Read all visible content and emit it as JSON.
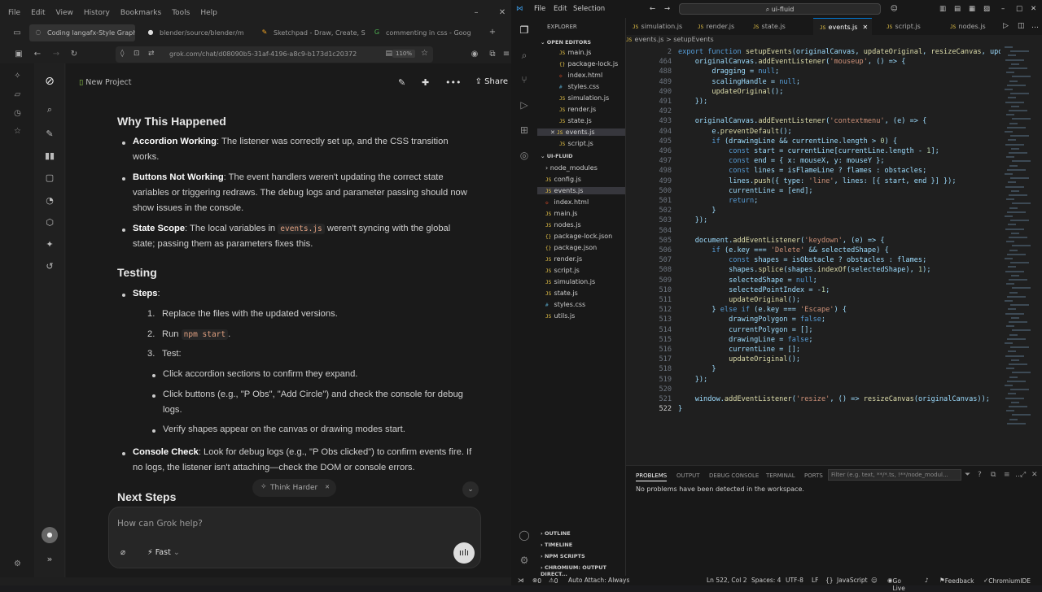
{
  "ff": {
    "menu": [
      "File",
      "Edit",
      "View",
      "History",
      "Bookmarks",
      "Tools",
      "Help"
    ],
    "tabs": [
      "Coding langafx-Style Graph",
      "blender/source/blender/m",
      "Sketchpad - Draw, Create, S",
      "commenting in css - Goog"
    ],
    "url": "grok.com/chat/d08090b5-31af-4196-a8c9-b173d1c20372",
    "zoom": "110%"
  },
  "grok": {
    "project": "New Project",
    "share": "Share",
    "h_why": "Why This Happened",
    "why": [
      {
        "b": "Accordion Working",
        "t": ": The listener was correctly set up, and the CSS transition works."
      },
      {
        "b": "Buttons Not Working",
        "t": ": The event handlers weren't updating the correct state variables or triggering redraws. The debug logs and parameter passing should now show issues in the console."
      },
      {
        "b": "State Scope",
        "t1": ": The local variables in ",
        "code": "events.js",
        "t2": " weren't syncing with the global state; passing them as parameters fixes this."
      }
    ],
    "h_test": "Testing",
    "steps": "Steps",
    "s1": "Replace the files with the updated versions.",
    "s2a": "Run ",
    "s2code": "npm start",
    "s2b": ".",
    "s3": "Test:",
    "sub": [
      "Click accordion sections to confirm they expand.",
      "Click buttons (e.g., \"P Obs\", \"Add Circle\") and check the console for debug logs.",
      "Verify shapes appear on the canvas or drawing modes start."
    ],
    "console_b": "Console Check",
    "console_t": ": Look for debug logs (e.g., \"P Obs clicked\") to confirm events fire. If no logs, the listener isn't attaching—check the DOM or console errors.",
    "h_next": "Next Steps",
    "think": "Think Harder",
    "placeholder": "How can Grok help?",
    "fast": "Fast"
  },
  "vs": {
    "menu": [
      "File",
      "Edit",
      "Selection"
    ],
    "search": "ui-fluid",
    "explorer": "EXPLORER",
    "open_editors": "OPEN EDITORS",
    "folder": "UI-FLUID",
    "open_files": [
      "main.js",
      "package-lock.js",
      "index.html",
      "styles.css",
      "simulation.js",
      "render.js",
      "state.js",
      "events.js",
      "script.js"
    ],
    "folder_files": [
      "node_modules",
      "config.js",
      "events.js",
      "index.html",
      "main.js",
      "nodes.js",
      "package-lock.json",
      "package.json",
      "render.js",
      "script.js",
      "simulation.js",
      "state.js",
      "styles.css",
      "utils.js"
    ],
    "bottom_sections": [
      "OUTLINE",
      "TIMELINE",
      "NPM SCRIPTS",
      "CHROMIUM: OUTPUT DIRECT..."
    ],
    "tabs": [
      "simulation.js",
      "render.js",
      "state.js",
      "events.js",
      "script.js",
      "nodes.js"
    ],
    "breadcrumb": "events.js > setupEvents",
    "code": [
      {
        "n": "2",
        "t": "export function setupEvents(originalCanvas, updateOriginal, resizeCanvas, upd"
      },
      {
        "n": "464",
        "t": "    originalCanvas.addEventListener('mouseup', () => {"
      },
      {
        "n": "488",
        "t": "        dragging = null;"
      },
      {
        "n": "489",
        "t": "        scalingHandle = null;"
      },
      {
        "n": "490",
        "t": "        updateOriginal();"
      },
      {
        "n": "491",
        "t": "    });"
      },
      {
        "n": "492",
        "t": ""
      },
      {
        "n": "493",
        "t": "    originalCanvas.addEventListener('contextmenu', (e) => {"
      },
      {
        "n": "494",
        "t": "        e.preventDefault();"
      },
      {
        "n": "495",
        "t": "        if (drawingLine && currentLine.length > 0) {"
      },
      {
        "n": "496",
        "t": "            const start = currentLine[currentLine.length - 1];"
      },
      {
        "n": "497",
        "t": "            const end = { x: mouseX, y: mouseY };"
      },
      {
        "n": "498",
        "t": "            const lines = isFlameLine ? flames : obstacles;"
      },
      {
        "n": "499",
        "t": "            lines.push({ type: 'line', lines: [{ start, end }] });"
      },
      {
        "n": "500",
        "t": "            currentLine = [end];"
      },
      {
        "n": "501",
        "t": "            return;"
      },
      {
        "n": "502",
        "t": "        }"
      },
      {
        "n": "503",
        "t": "    });"
      },
      {
        "n": "504",
        "t": ""
      },
      {
        "n": "505",
        "t": "    document.addEventListener('keydown', (e) => {"
      },
      {
        "n": "506",
        "t": "        if (e.key === 'Delete' && selectedShape) {"
      },
      {
        "n": "507",
        "t": "            const shapes = isObstacle ? obstacles : flames;"
      },
      {
        "n": "508",
        "t": "            shapes.splice(shapes.indexOf(selectedShape), 1);"
      },
      {
        "n": "509",
        "t": "            selectedShape = null;"
      },
      {
        "n": "510",
        "t": "            selectedPointIndex = -1;"
      },
      {
        "n": "511",
        "t": "            updateOriginal();"
      },
      {
        "n": "512",
        "t": "        } else if (e.key === 'Escape') {"
      },
      {
        "n": "513",
        "t": "            drawingPolygon = false;"
      },
      {
        "n": "514",
        "t": "            currentPolygon = [];"
      },
      {
        "n": "515",
        "t": "            drawingLine = false;"
      },
      {
        "n": "516",
        "t": "            currentLine = [];"
      },
      {
        "n": "517",
        "t": "            updateOriginal();"
      },
      {
        "n": "518",
        "t": "        }"
      },
      {
        "n": "519",
        "t": "    });"
      },
      {
        "n": "520",
        "t": ""
      },
      {
        "n": "521",
        "t": "    window.addEventListener('resize', () => resizeCanvas(originalCanvas));"
      },
      {
        "n": "522",
        "t": "}"
      }
    ],
    "panel_tabs": [
      "PROBLEMS",
      "OUTPUT",
      "DEBUG CONSOLE",
      "TERMINAL",
      "PORTS"
    ],
    "filter": "Filter (e.g. text, **/*.ts, !**/node_modul...",
    "problems": "No problems have been detected in the workspace.",
    "status": {
      "errors": "0",
      "warnings": "0",
      "attach": "Auto Attach: Always",
      "pos": "Ln 522, Col 2",
      "spaces": "Spaces: 4",
      "enc": "UTF-8",
      "eol": "LF",
      "lang": "JavaScript",
      "live": "Go Live",
      "feedback": "Feedback",
      "ide": "ChromiumIDE"
    }
  }
}
